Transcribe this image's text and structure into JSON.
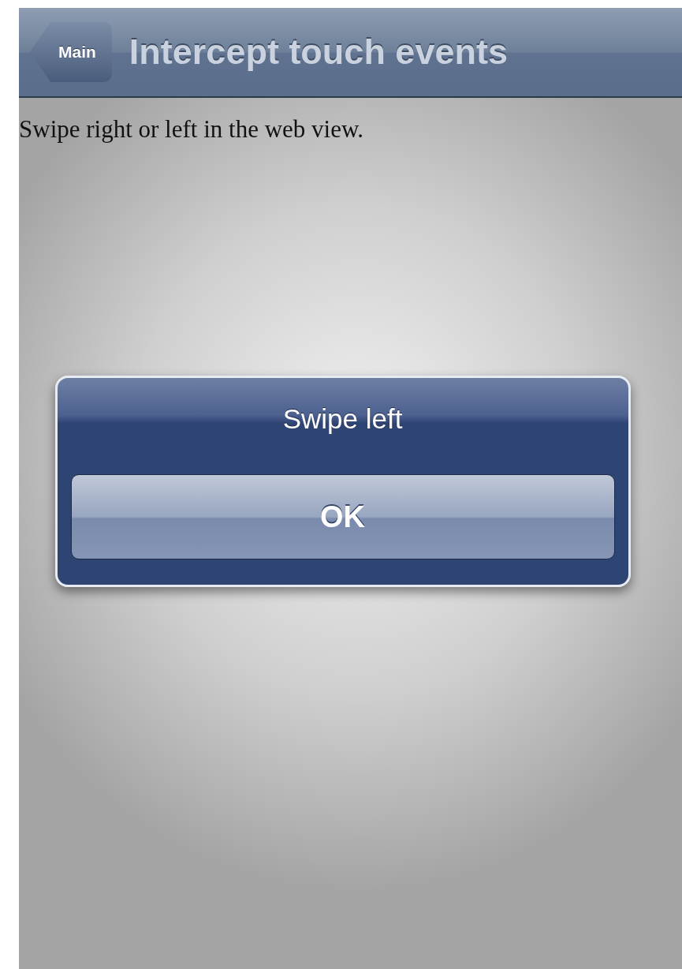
{
  "nav": {
    "back": "Main",
    "title": "Intercept touch events"
  },
  "content": {
    "text": "Swipe right or left in the web view."
  },
  "alert": {
    "message": "Swipe left",
    "buttons": [
      "OK"
    ]
  }
}
